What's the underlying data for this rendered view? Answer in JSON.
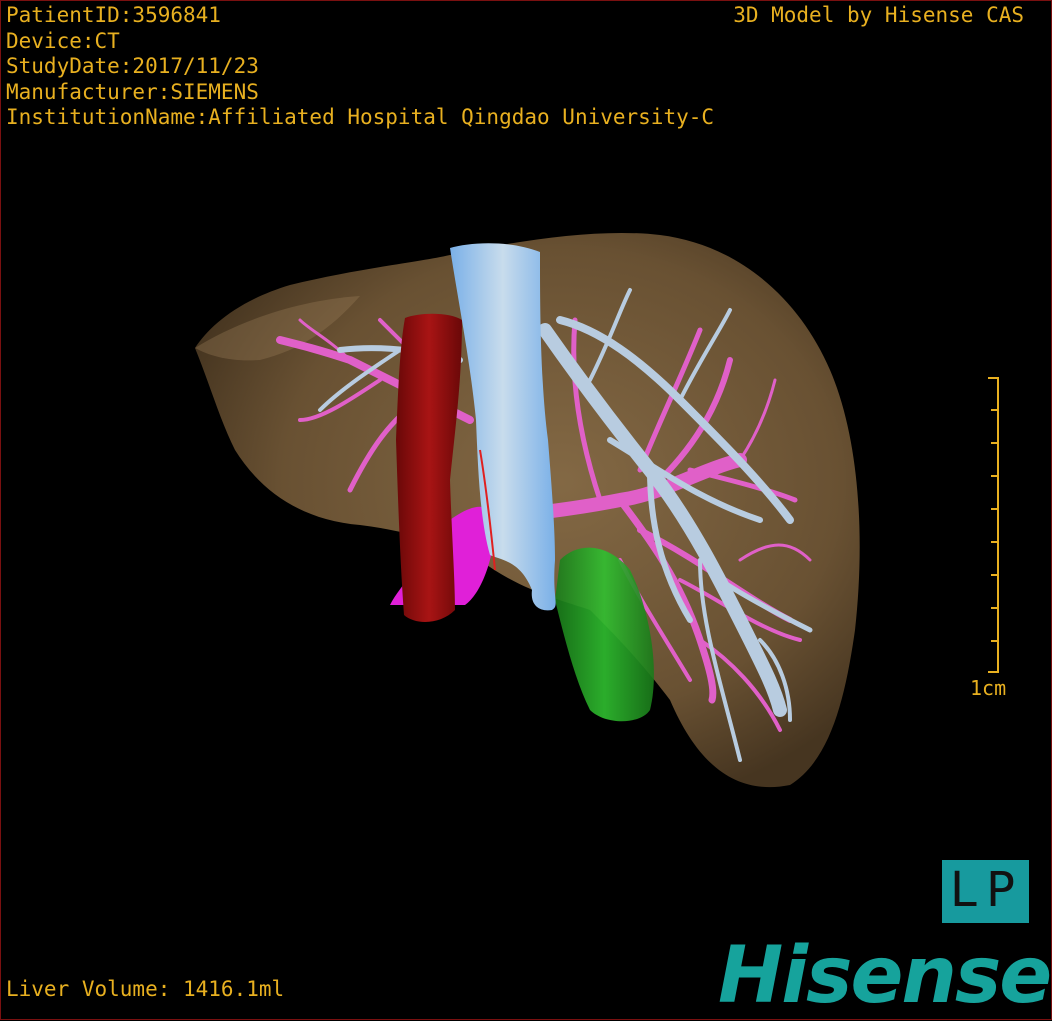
{
  "header": {
    "patient_id": "PatientID:3596841",
    "device": "Device:CT",
    "study_date": "StudyDate:2017/11/23",
    "manufacturer": "Manufacturer:SIEMENS",
    "institution": "InstitutionName:Affiliated Hospital Qingdao University-C"
  },
  "brand_top": "3D Model by Hisense CAS",
  "scale_label": "1cm",
  "footer": {
    "liver_volume": "Liver Volume: 1416.1ml"
  },
  "orientation": {
    "left": "L",
    "right": "P"
  },
  "logo": "Hisense",
  "colors": {
    "text": "#e8b020",
    "liver": "#7a6040",
    "vena_cava": "#a8c8e8",
    "portal_vein": "#e060c8",
    "aorta": "#9a1010",
    "gallbladder": "#20a020",
    "logo": "#16a39c"
  }
}
